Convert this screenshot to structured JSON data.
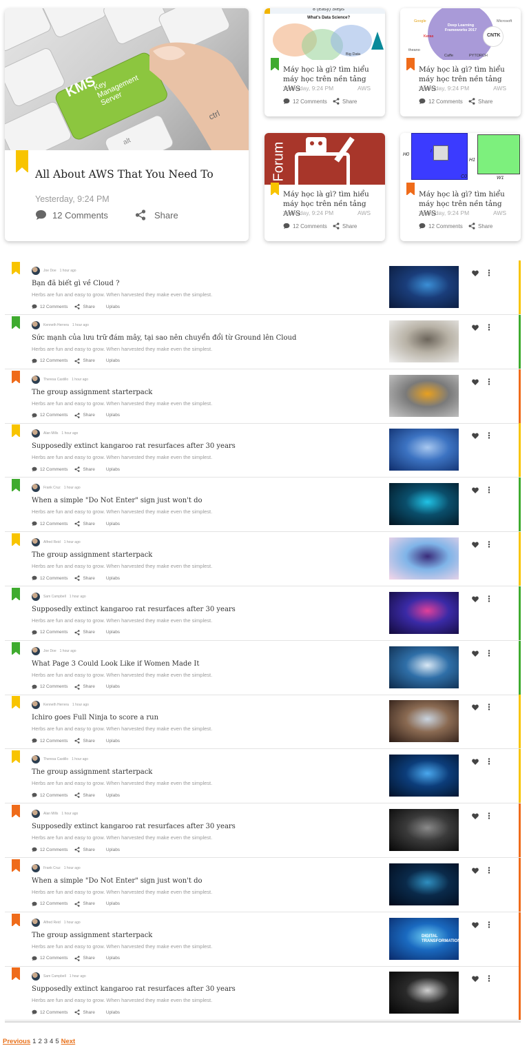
{
  "colors": {
    "yellow": "#f8c400",
    "green": "#3fab2f",
    "orange": "#ef6b1a"
  },
  "featured": {
    "title": "All About AWS That You Need To",
    "date": "Yesterday, 9:24 PM",
    "comments": "12 Comments",
    "share": "Share",
    "ribbon": "yellow",
    "image_text": {
      "kms": "KMS",
      "key": "Key",
      "management": "Management",
      "server": "Server",
      "ctrl": "ctrl",
      "alt": "alt"
    }
  },
  "small_cards": [
    {
      "title": "Máy học là gì? tìm hiểu máy học trên nền tảng AWS",
      "date": "Yesterday, 9:24 PM",
      "tag": "AWS",
      "comments": "12 Comments",
      "share": "Share",
      "ribbon": "green",
      "image_text": {
        "top": "8 (Easy) Steps",
        "heading": "What's Data Science?",
        "bigdata": "Big Data"
      }
    },
    {
      "title": "Máy học là gì? tìm hiểu máy học trên nền tảng AWS",
      "date": "Yesterday, 9:24 PM",
      "tag": "AWS",
      "comments": "12 Comments",
      "share": "Share",
      "ribbon": "orange",
      "image_text": {
        "center": "Deep Learning Frameworks 2017",
        "google": "Google",
        "microsoft": "Microsoft",
        "cntk": "CNTK",
        "keras": "Keras",
        "caffe": "Caffe",
        "pytorch": "PYTORCH",
        "theano": "theano"
      }
    },
    {
      "title": "Máy học là gì? tìm hiểu máy học trên nền tảng AWS",
      "date": "Yesterday, 9:24 PM",
      "tag": "AWS",
      "comments": "12 Comments",
      "share": "Share",
      "ribbon": "yellow",
      "image_text": {
        "forum": "Forum"
      }
    },
    {
      "title": "Máy học là gì? tìm hiểu máy học trên nền tảng AWS",
      "date": "Yesterday, 9:24 PM",
      "tag": "AWS",
      "comments": "12 Comments",
      "share": "Share",
      "ribbon": "orange",
      "image_text": {
        "h0": "H0",
        "h1": "H1",
        "c0": "C0",
        "w1": "W1",
        "i": "I"
      }
    }
  ],
  "list": [
    {
      "author": "Joe Doe",
      "time": "1 hour ago",
      "title": "Bạn đã biết gì về Cloud ?",
      "excerpt": "Herbs are fun and easy to grow. When harvested they make even the simplest.",
      "comments": "12 Comments",
      "share": "Share",
      "tag": "Uplabs",
      "color": "yellow",
      "thumb": [
        "#0b1a3a",
        "#1a3d7a",
        "#3b8fd6"
      ]
    },
    {
      "author": "Kenneth Herrera",
      "time": "1 hour ago",
      "title": "Sức mạnh của lưu trữ đám mây, tại sao nên chuyển đổi từ Ground lên Cloud",
      "excerpt": "Herbs are fun and easy to grow. When harvested they make even the simplest.",
      "comments": "12 Comments",
      "share": "Share",
      "tag": "Uplabs",
      "color": "green",
      "thumb": [
        "#f2f2f2",
        "#b8b2a6",
        "#6c655b"
      ]
    },
    {
      "author": "Theresa Castillo",
      "time": "1 hour ago",
      "title": "The group assignment starterpack",
      "excerpt": "Herbs are fun and easy to grow. When harvested they make even the simplest.",
      "comments": "12 Comments",
      "share": "Share",
      "tag": "Uplabs",
      "color": "orange",
      "thumb": [
        "#c9c9c9",
        "#7a7a7a",
        "#e8a020"
      ]
    },
    {
      "author": "Alan Mills",
      "time": "1 hour ago",
      "title": "Supposedly extinct kangaroo rat resurfaces after 30 years",
      "excerpt": "Herbs are fun and easy to grow. When harvested they make even the simplest.",
      "comments": "12 Comments",
      "share": "Share",
      "tag": "Uplabs",
      "color": "yellow",
      "thumb": [
        "#0f2d6b",
        "#3c73c2",
        "#a8c8f0"
      ]
    },
    {
      "author": "Frank Cruz",
      "time": "1 hour ago",
      "title": "When a simple \"Do Not Enter\" sign just won't do",
      "excerpt": "Herbs are fun and easy to grow. When harvested they make even the simplest.",
      "comments": "12 Comments",
      "share": "Share",
      "tag": "Uplabs",
      "color": "green",
      "thumb": [
        "#02131f",
        "#0a4e6b",
        "#21c3e6"
      ]
    },
    {
      "author": "Alfred Reid",
      "time": "1 hour ago",
      "title": "The group assignment starterpack",
      "excerpt": "Herbs are fun and easy to grow. When harvested they make even the simplest.",
      "comments": "12 Comments",
      "share": "Share",
      "tag": "Uplabs",
      "color": "yellow",
      "thumb": [
        "#f6d6e8",
        "#7fb4e8",
        "#3a2c7a"
      ]
    },
    {
      "author": "Sam Campbell",
      "time": "1 hour ago",
      "title": "Supposedly extinct kangaroo rat resurfaces after 30 years",
      "excerpt": "Herbs are fun and easy to grow. When harvested they make even the simplest.",
      "comments": "12 Comments",
      "share": "Share",
      "tag": "Uplabs",
      "color": "green",
      "thumb": [
        "#120a3a",
        "#3a2aa6",
        "#e0409a"
      ]
    },
    {
      "author": "Joe Doe",
      "time": "1 hour ago",
      "title": "What Page 3 Could Look Like if Women Made It",
      "excerpt": "Herbs are fun and easy to grow. When harvested they make even the simplest.",
      "comments": "12 Comments",
      "share": "Share",
      "tag": "Uplabs",
      "color": "green",
      "thumb": [
        "#0d2a4a",
        "#2f6fa8",
        "#d9e8f5"
      ]
    },
    {
      "author": "Kenneth Herrera",
      "time": "1 hour ago",
      "title": "Ichiro goes Full Ninja to score a run",
      "excerpt": "Herbs are fun and easy to grow. When harvested they make even the simplest.",
      "comments": "12 Comments",
      "share": "Share",
      "tag": "Uplabs",
      "color": "yellow",
      "thumb": [
        "#2a1a14",
        "#8a6a52",
        "#c9d4e0"
      ]
    },
    {
      "author": "Theresa Castillo",
      "time": "1 hour ago",
      "title": "The group assignment starterpack",
      "excerpt": "Herbs are fun and easy to grow. When harvested they make even the simplest.",
      "comments": "12 Comments",
      "share": "Share",
      "tag": "Uplabs",
      "color": "yellow",
      "thumb": [
        "#021026",
        "#0c3d7a",
        "#4aa8ee"
      ]
    },
    {
      "author": "Alan Mills",
      "time": "1 hour ago",
      "title": "Supposedly extinct kangaroo rat resurfaces after 30 years",
      "excerpt": "Herbs are fun and easy to grow. When harvested they make even the simplest.",
      "comments": "12 Comments",
      "share": "Share",
      "tag": "Uplabs",
      "color": "orange",
      "thumb": [
        "#060606",
        "#3a3a3a",
        "#8a8a8a"
      ]
    },
    {
      "author": "Frank Cruz",
      "time": "1 hour ago",
      "title": "When a simple \"Do Not Enter\" sign just won't do",
      "excerpt": "Herbs are fun and easy to grow. When harvested they make even the simplest.",
      "comments": "12 Comments",
      "share": "Share",
      "tag": "Uplabs",
      "color": "orange",
      "thumb": [
        "#020a1a",
        "#0a2a4a",
        "#2f8fc0"
      ]
    },
    {
      "author": "Alfred Reid",
      "time": "1 hour ago",
      "title": "The group assignment starterpack",
      "excerpt": "Herbs are fun and easy to grow. When harvested they make even the simplest.",
      "comments": "12 Comments",
      "share": "Share",
      "tag": "Uplabs",
      "color": "orange",
      "thumb": [
        "#0a2a6a",
        "#1a6ac0",
        "#6fd0f5"
      ],
      "thumb_text": "DIGITAL TRANSFORMATION"
    },
    {
      "author": "Sam Campbell",
      "time": "1 hour ago",
      "title": "Supposedly extinct kangaroo rat resurfaces after 30 years",
      "excerpt": "Herbs are fun and easy to grow. When harvested they make even the simplest.",
      "comments": "12 Comments",
      "share": "Share",
      "tag": "Uplabs",
      "color": "orange",
      "thumb": [
        "#050505",
        "#2a2a2a",
        "#d0d0d0"
      ]
    }
  ],
  "pagination": {
    "previous": "Previous",
    "pages": [
      "1",
      "2",
      "3",
      "4",
      "5"
    ],
    "next": "Next"
  }
}
